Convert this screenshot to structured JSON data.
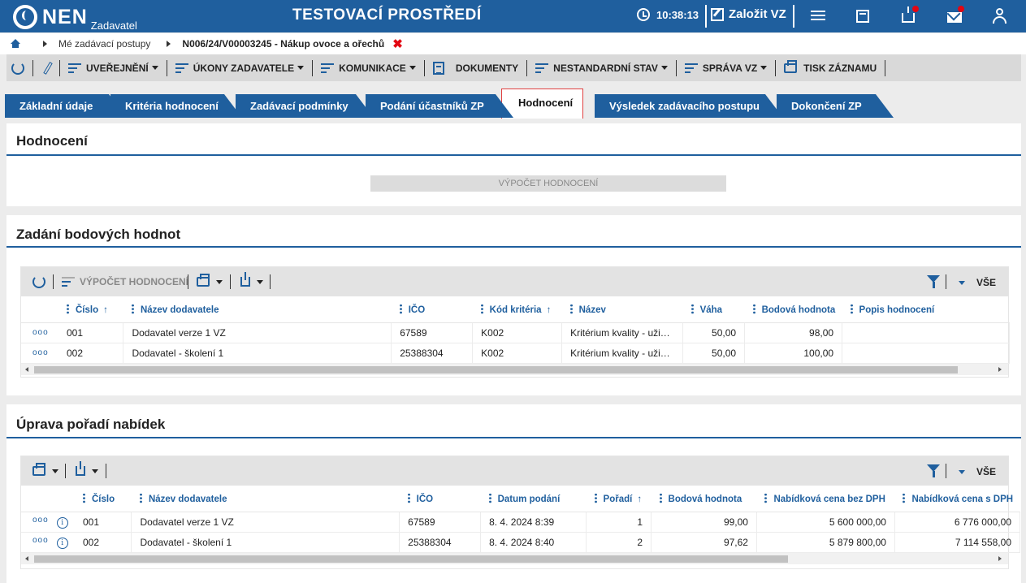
{
  "header": {
    "logo": "NEN",
    "logo_sub": "Zadavatel",
    "env_title": "TESTOVACÍ PROSTŘEDÍ",
    "time": "10:38:13",
    "create_label": "Založit VZ"
  },
  "breadcrumb": {
    "item1": "Mé zadávací postupy",
    "current": "N006/24/V00003245 - Nákup ovoce a ořechů"
  },
  "toolbar": {
    "publish": "UVEŘEJNĚNÍ",
    "acts": "ÚKONY ZADAVATELE",
    "communication": "KOMUNIKACE",
    "documents": "DOKUMENTY",
    "nonstandard": "NESTANDARDNÍ STAV",
    "manage": "SPRÁVA VZ",
    "print": "TISK ZÁZNAMU"
  },
  "tabs": [
    {
      "label": "Základní údaje"
    },
    {
      "label": "Kritéria hodnocení"
    },
    {
      "label": "Zadávací podmínky"
    },
    {
      "label": "Podání účastníků ZP"
    },
    {
      "label": "Hodnocení"
    },
    {
      "label": "Výsledek zadávacího postupu"
    },
    {
      "label": "Dokončení ZP"
    }
  ],
  "panel1": {
    "title": "Hodnocení",
    "button": "VÝPOČET HODNOCENÍ"
  },
  "panel2": {
    "title": "Zadání bodových hodnot",
    "calc_label": "VÝPOČET HODNOCENÍ",
    "all_label": "VŠE",
    "columns": [
      "Číslo",
      "Název dodavatele",
      "IČO",
      "Kód kritéria",
      "Název",
      "Váha",
      "Bodová hodnota",
      "Popis hodnocení"
    ],
    "rows": [
      {
        "ctl": "ooo",
        "cislo": "001",
        "nazev": "Dodavatel verze 1 VZ",
        "ico": "67589",
        "kod": "K002",
        "krit": "Kritérium kvality - uži…",
        "vaha": "50,00",
        "body": "98,00",
        "popis": ""
      },
      {
        "ctl": "ooo",
        "cislo": "002",
        "nazev": "Dodavatel - školení 1",
        "ico": "25388304",
        "kod": "K002",
        "krit": "Kritérium kvality - uži…",
        "vaha": "50,00",
        "body": "100,00",
        "popis": ""
      }
    ]
  },
  "panel3": {
    "title": "Úprava pořadí nabídek",
    "all_label": "VŠE",
    "columns": [
      "Číslo",
      "Název dodavatele",
      "IČO",
      "Datum podání",
      "Pořadí",
      "Bodová hodnota",
      "Nabídková cena bez DPH",
      "Nabídková cena s DPH"
    ],
    "rows": [
      {
        "ctl": "ooo",
        "info": "i",
        "cislo": "001",
        "nazev": "Dodavatel verze 1 VZ",
        "ico": "67589",
        "datum": "8. 4. 2024 8:39",
        "poradi": "1",
        "body": "99,00",
        "bez": "5 600 000,00",
        "s": "6 776 000,00"
      },
      {
        "ctl": "ooo",
        "info": "i",
        "cislo": "002",
        "nazev": "Dodavatel - školení 1",
        "ico": "25388304",
        "datum": "8. 4. 2024 8:40",
        "poradi": "2",
        "body": "97,62",
        "bez": "5 879 800,00",
        "s": "7 114 558,00"
      }
    ]
  }
}
